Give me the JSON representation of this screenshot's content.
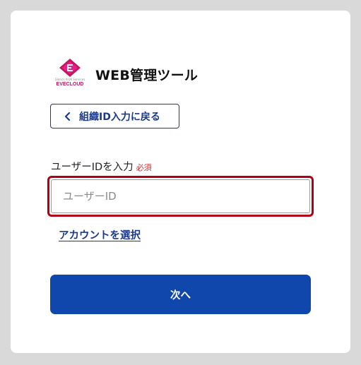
{
  "header": {
    "logo_sub": "Glorics AIUK Services",
    "logo_brand": "EVECLOUD",
    "title": "WEB管理ツール"
  },
  "back_button": {
    "label": "組織ID入力に戻る"
  },
  "user_id_field": {
    "label": "ユーザーIDを入力",
    "required": "必須",
    "placeholder": "ユーザーID",
    "value": ""
  },
  "account_link": {
    "label": "アカウントを選択"
  },
  "next_button": {
    "label": "次へ"
  },
  "colors": {
    "accent": "#0f47ad",
    "link": "#1a3a8c",
    "error_border": "#b00015",
    "required": "#d32f2f",
    "logo": "#c2185b"
  }
}
